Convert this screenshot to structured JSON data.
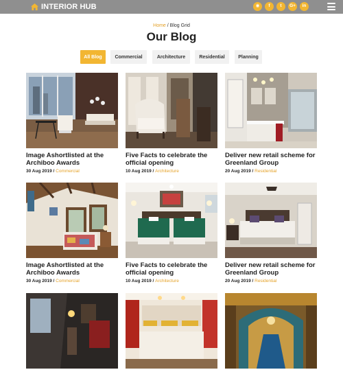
{
  "header": {
    "brand": "INTERIOR HUB",
    "brand_icon": "home-icon",
    "socials": [
      {
        "icon": "rss-icon",
        "glyph": "◉"
      },
      {
        "icon": "facebook-icon",
        "glyph": "f"
      },
      {
        "icon": "twitter-icon",
        "glyph": "t"
      },
      {
        "icon": "google-plus-icon",
        "glyph": "G+"
      },
      {
        "icon": "linkedin-icon",
        "glyph": "in"
      }
    ],
    "menu_icon": "menu-icon",
    "accent": "#f2b632",
    "bar_color": "#8f8f8f"
  },
  "breadcrumb": {
    "home": "Home",
    "separator": " / ",
    "current": "Blog Grid"
  },
  "page_title": "Our Blog",
  "filters": [
    {
      "label": "All Blog",
      "active": true
    },
    {
      "label": "Commercial",
      "active": false
    },
    {
      "label": "Architecture",
      "active": false
    },
    {
      "label": "Residential",
      "active": false
    },
    {
      "label": "Planning",
      "active": false
    }
  ],
  "posts": [
    {
      "title": "Image Ashortlisted at the Archiboo Awards",
      "date": "30 Aug 2019",
      "separator": " / ",
      "category": "Commercial"
    },
    {
      "title": "Five Facts to celebrate the official opening",
      "date": "10 Aug 2019",
      "separator": " / ",
      "category": "Architecture"
    },
    {
      "title": "Deliver new retail scheme for Greenland Group",
      "date": "20 Aug 2019",
      "separator": " / ",
      "category": "Residential"
    },
    {
      "title": "Image Ashortlisted at the Archiboo Awards",
      "date": "30 Aug 2019",
      "separator": " / ",
      "category": "Commercial"
    },
    {
      "title": "Five Facts to celebrate the official opening",
      "date": "10 Aug 2019",
      "separator": " / ",
      "category": "Architecture"
    },
    {
      "title": "Deliver new retail scheme for Greenland Group",
      "date": "20 Aug 2019",
      "separator": " / ",
      "category": "Residential"
    },
    {
      "title": "",
      "date": "",
      "separator": "",
      "category": ""
    },
    {
      "title": "",
      "date": "",
      "separator": "",
      "category": ""
    },
    {
      "title": "",
      "date": "",
      "separator": "",
      "category": ""
    }
  ]
}
